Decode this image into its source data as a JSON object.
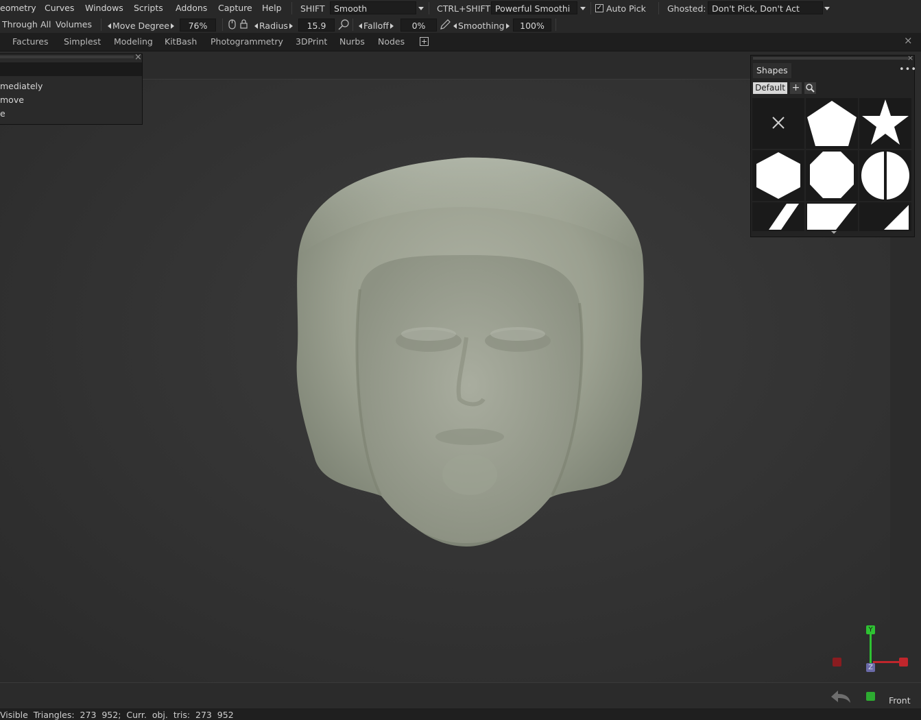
{
  "menubar": {
    "items": [
      "eometry",
      "Curves",
      "Windows",
      "Scripts",
      "Addons",
      "Capture",
      "Help"
    ],
    "shift_label": "SHIFT",
    "shift_value": "Smooth",
    "ctrl_shift_label": "CTRL+SHIFT",
    "ctrl_shift_value": "Powerful Smoothi",
    "auto_pick_label": "Auto Pick",
    "auto_pick_checked": true,
    "ghosted_label": "Ghosted:",
    "ghosted_value": "Don't Pick, Don't Act"
  },
  "toolbar": {
    "through_label": "Through",
    "all_label": "All",
    "volumes_label": "Volumes",
    "move_degree_label": "Move Degree",
    "move_degree_value": "76%",
    "radius_label": "Radius",
    "radius_value": "15.9",
    "falloff_label": "Falloff",
    "falloff_value": "0%",
    "smoothing_label": "Smoothing",
    "smoothing_value": "100%"
  },
  "tabs": [
    "Factures",
    "Simplest",
    "Modeling",
    "KitBash",
    "Photogrammetry",
    "3DPrint",
    "Nurbs",
    "Nodes"
  ],
  "left_popup": {
    "lines": [
      "mediately",
      "move",
      "e"
    ]
  },
  "shapes_panel": {
    "title": "Shapes",
    "preset": "Default",
    "shapes": [
      "none-icon",
      "pentagon-icon",
      "star-icon",
      "hexagon-icon",
      "octagon-icon",
      "half-circle-icon",
      "parallelogram-icon",
      "trapezoid-icon",
      "triangle-icon"
    ]
  },
  "gizmo": {
    "y_label": "Y",
    "z_label": "Z",
    "x_color": "#c0262c",
    "y_color": "#2ec232",
    "z_color": "#6a6aa8"
  },
  "view_label": "Front",
  "status": {
    "text": "Visible  Triangles:  273  952;  Curr.  obj.  tris:  273  952"
  },
  "colors": {
    "background": "#2f2f2f",
    "panel": "#232323",
    "field": "#1d1d1d",
    "model": "#9ea394"
  }
}
